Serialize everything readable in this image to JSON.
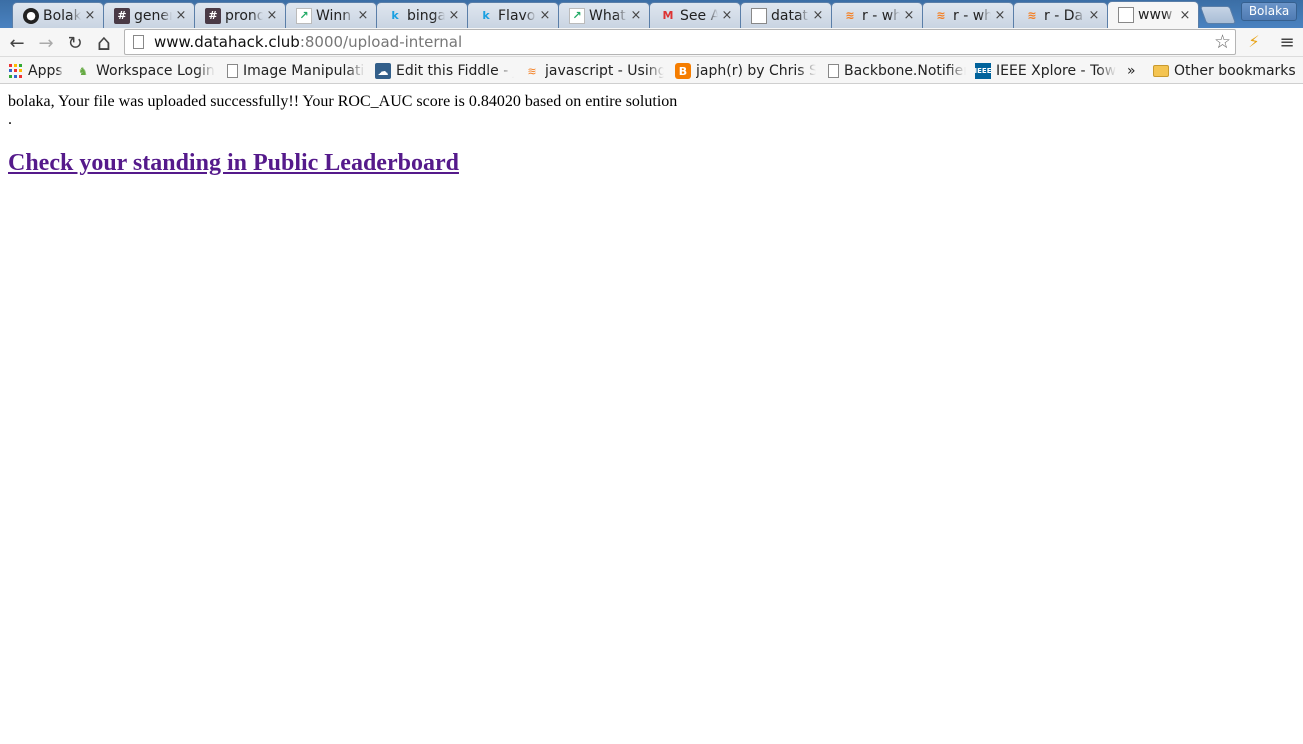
{
  "tabs": [
    {
      "icon": "github-icon",
      "glyph": "●",
      "title": "Bolaka"
    },
    {
      "icon": "hashtag-icon",
      "glyph": "#",
      "title": "general"
    },
    {
      "icon": "hashtag-icon",
      "glyph": "#",
      "title": "prono"
    },
    {
      "icon": "chart-icon",
      "glyph": "↗",
      "title": "Winn"
    },
    {
      "icon": "kaggle-icon",
      "glyph": "k",
      "title": "binga"
    },
    {
      "icon": "kaggle-icon",
      "glyph": "k",
      "title": "Flavo"
    },
    {
      "icon": "chart-icon",
      "glyph": "↗",
      "title": "What"
    },
    {
      "icon": "gmail-icon",
      "glyph": "M",
      "title": "See A"
    },
    {
      "icon": "document-icon",
      "glyph": "",
      "title": "datat"
    },
    {
      "icon": "stackoverflow-icon",
      "glyph": "≋",
      "title": "r - wh"
    },
    {
      "icon": "stackoverflow-icon",
      "glyph": "≋",
      "title": "r - wh"
    },
    {
      "icon": "stackoverflow-icon",
      "glyph": "≋",
      "title": "r - Da"
    },
    {
      "icon": "document-icon",
      "glyph": "",
      "title": "www"
    }
  ],
  "tab_close_glyph": "×",
  "profile_name": "Bolaka",
  "toolbar": {
    "back_glyph": "←",
    "forward_glyph": "→",
    "reload_glyph": "↻",
    "home_glyph": "⌂",
    "star_glyph": "☆",
    "extension_glyph": "⚡",
    "menu_glyph": "≡"
  },
  "address": {
    "host": "www.datahack.club",
    "rest": ":8000/upload-internal"
  },
  "bookmarks": [
    {
      "icon": "apps-icon",
      "label": "Apps"
    },
    {
      "icon": "person-icon",
      "label": "Workspace Login"
    },
    {
      "icon": "document-icon",
      "label": "Image Manipulation"
    },
    {
      "icon": "cloud-icon",
      "label": "Edit this Fiddle - jsFiddle"
    },
    {
      "icon": "stackoverflow-icon",
      "label": "javascript - Using"
    },
    {
      "icon": "blogger-icon",
      "label": "japh(r) by Chris Strom"
    },
    {
      "icon": "document-icon",
      "label": "Backbone.Notifier"
    },
    {
      "icon": "ieee-icon",
      "label": "IEEE Xplore - Towards"
    }
  ],
  "bookmarks_overflow_glyph": "»",
  "other_bookmarks_label": "Other bookmarks",
  "page": {
    "message": "bolaka, Your file was uploaded successfully!! Your ROC_AUC score is 0.84020 based on entire solution",
    "dot": ".",
    "leaderboard_link": "Check your standing in Public Leaderboard"
  }
}
